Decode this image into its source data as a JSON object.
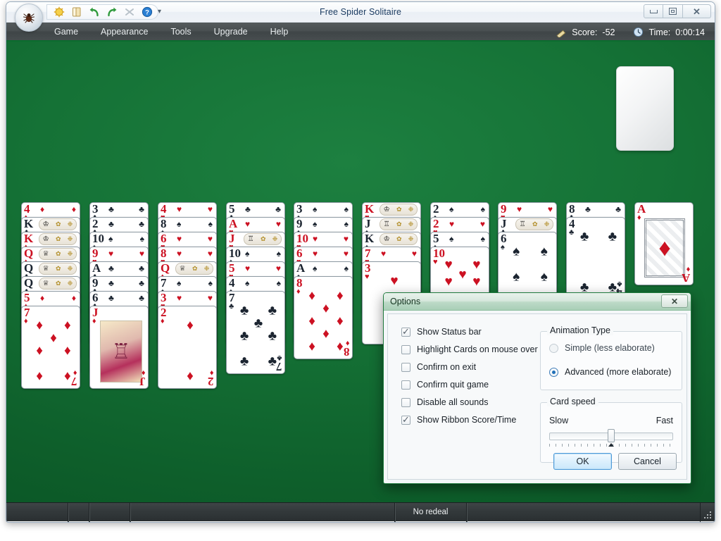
{
  "window": {
    "title": "Free Spider Solitaire",
    "controls": {
      "minimize": "minimize-button",
      "maximize": "maximize-button",
      "close": "close-button"
    }
  },
  "quick_access": {
    "orb_icon": "spider-orb-icon",
    "items": [
      {
        "name": "new-game-icon",
        "glyph": "☀"
      },
      {
        "name": "deal-cards-icon",
        "glyph": "🃏"
      },
      {
        "name": "undo-icon",
        "glyph": "↰"
      },
      {
        "name": "redo-icon",
        "glyph": "↱"
      },
      {
        "name": "hint-icon",
        "glyph": "✕"
      },
      {
        "name": "help-icon",
        "glyph": "?"
      }
    ],
    "more_glyph": "▾"
  },
  "menu": {
    "items": [
      "Game",
      "Appearance",
      "Tools",
      "Upgrade",
      "Help"
    ]
  },
  "ribbon_status": {
    "score_label": "Score:",
    "score_value": "-52",
    "time_label": "Time:",
    "time_value": "0:00:14"
  },
  "status_bar": {
    "redeal_text": "No redeal"
  },
  "game": {
    "stock_slot_label": "stock-pile",
    "columns": [
      {
        "cards": [
          "4♦",
          "K♣",
          "K♦",
          "Q♦",
          "Q♣",
          "Q♣",
          "5♦",
          "7♦"
        ],
        "face_up_bottom": "7♦"
      },
      {
        "cards": [
          "3♣",
          "2♣",
          "10♠",
          "9♥",
          "A♣",
          "9♣",
          "6♣",
          "J♦"
        ],
        "face_up_bottom": "J♦"
      },
      {
        "cards": [
          "4♥",
          "8♠",
          "6♥",
          "8♥",
          "Q♦",
          "7♠",
          "3♥",
          "2♦"
        ],
        "face_up_bottom": "2♦"
      },
      {
        "cards": [
          "5♣",
          "A♥",
          "J♥",
          "10♠",
          "5♥",
          "4♠",
          "7♣"
        ],
        "face_up_bottom": "7♣"
      },
      {
        "cards": [
          "3♠",
          "9♠",
          "10♥",
          "6♥",
          "A♠",
          "8♦"
        ],
        "face_up_bottom": "8♦"
      },
      {
        "cards": [
          "K♥",
          "J♠",
          "K♠",
          "7♥",
          "3♥"
        ],
        "face_up_bottom": "3♥"
      },
      {
        "cards": [
          "2♠",
          "2♥",
          "5♠",
          "10♥"
        ],
        "face_up_bottom": "10♥"
      },
      {
        "cards": [
          "9♥",
          "J♣",
          "6♠"
        ],
        "face_up_bottom": "6♠"
      },
      {
        "cards": [
          "8♣",
          "4♣"
        ],
        "face_up_bottom": "4♣"
      },
      {
        "cards": [
          "A♦"
        ],
        "face_up_bottom": "A♦"
      }
    ]
  },
  "options_dialog": {
    "title": "Options",
    "close_glyph": "✕",
    "checkboxes": [
      {
        "label": "Show Status bar",
        "checked": true
      },
      {
        "label": "Highlight Cards on mouse over",
        "checked": false
      },
      {
        "label": "Confirm on exit",
        "checked": false
      },
      {
        "label": "Confirm quit game",
        "checked": false
      },
      {
        "label": "Disable all sounds",
        "checked": false
      },
      {
        "label": "Show Ribbon Score/Time",
        "checked": true
      }
    ],
    "animation": {
      "group_title": "Animation Type",
      "options": [
        {
          "label": "Simple (less elaborate)",
          "selected": false,
          "disabled": true
        },
        {
          "label": "Advanced (more elaborate)",
          "selected": true,
          "disabled": false
        }
      ]
    },
    "card_speed": {
      "group_title": "Card speed",
      "min_label": "Slow",
      "max_label": "Fast",
      "value_percent": 50
    },
    "buttons": {
      "ok": "OK",
      "cancel": "Cancel"
    }
  },
  "colors": {
    "felt_green": "#15723 6",
    "accent_red": "#cc1122",
    "accent_black": "#1b2430",
    "ribbon_dark": "#474d4f",
    "dialog_green": "#a9cfb7",
    "default_button_blue": "#4f9ad8"
  }
}
